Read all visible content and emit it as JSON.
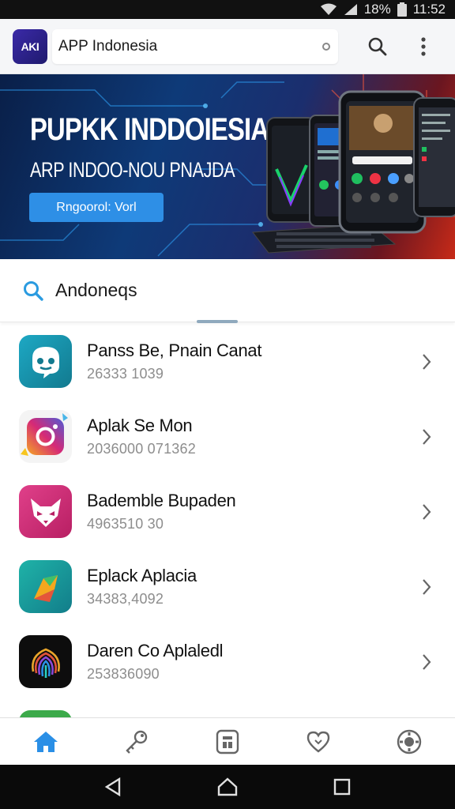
{
  "status_bar": {
    "battery_text": "18%",
    "time": "11:52"
  },
  "app_bar": {
    "logo_text": "AKI",
    "title": "APP Indonesia"
  },
  "hero": {
    "title": "PUPKK INDDOIESIA",
    "subtitle": "ARP INDOO-NOU PNAJDA",
    "cta_label": "Rngoorol: Vorl"
  },
  "search": {
    "value": "Andoneqs"
  },
  "apps": [
    {
      "name": "Panss Be, Pnain Canat",
      "code": "26333 1039",
      "icon": "chat-bot-icon",
      "color": "#1a8fae"
    },
    {
      "name": "Aplak Se Mon",
      "code": "2036000 071362",
      "icon": "camera-icon",
      "color": "#d1325f"
    },
    {
      "name": "Bademble Bupaden",
      "code": "4963510 30",
      "icon": "fox-mask-icon",
      "color": "#d0307a"
    },
    {
      "name": "Eplack Aplacia",
      "code": "34383,4092",
      "icon": "paper-arrow-icon",
      "color": "#1e9e94"
    },
    {
      "name": "Daren Co Aplaledl",
      "code": "253836090",
      "icon": "fingerprint-icon",
      "color": "#111111"
    }
  ],
  "bottom_nav": [
    "home-icon",
    "key-icon",
    "store-icon",
    "heart-icon",
    "settings-icon"
  ],
  "colors": {
    "accent": "#2e8fe6",
    "nav_active": "#2a8fe6"
  }
}
